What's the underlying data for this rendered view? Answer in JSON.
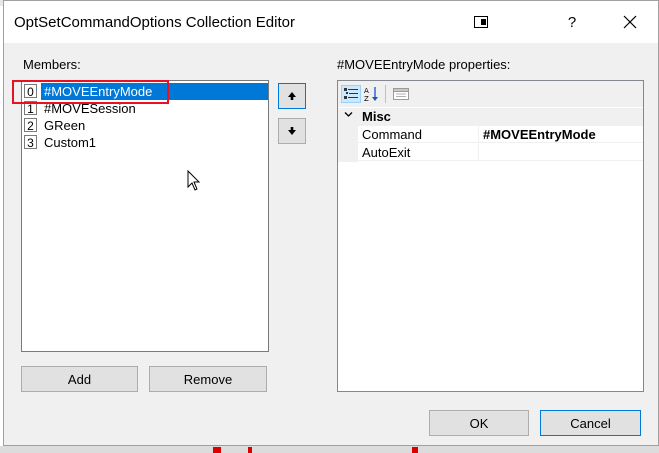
{
  "window": {
    "title": "OptSetCommandOptions Collection Editor"
  },
  "members": {
    "label": "Members:",
    "items": [
      {
        "index": "0",
        "name": "#MOVEEntryMode",
        "selected": true
      },
      {
        "index": "1",
        "name": "#MOVESession",
        "selected": false
      },
      {
        "index": "2",
        "name": "GReen",
        "selected": false
      },
      {
        "index": "3",
        "name": "Custom1",
        "selected": false
      }
    ],
    "add_label": "Add",
    "remove_label": "Remove"
  },
  "properties": {
    "label": "#MOVEEntryMode properties:",
    "category": "Misc",
    "rows": [
      {
        "name": "Command",
        "value": "#MOVEEntryMode"
      },
      {
        "name": "AutoExit",
        "value": ""
      }
    ]
  },
  "footer": {
    "ok_label": "OK",
    "cancel_label": "Cancel"
  },
  "colors": {
    "selection": "#0078d7",
    "highlight": "#e81123"
  }
}
